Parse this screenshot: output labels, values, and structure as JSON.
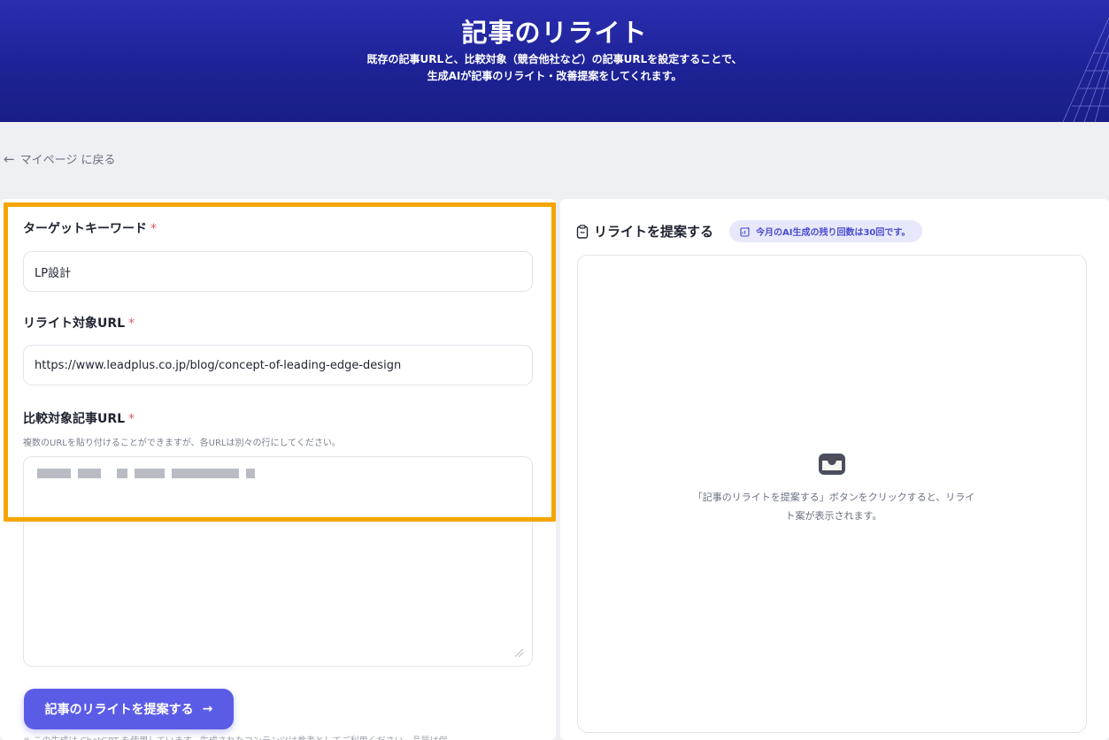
{
  "hero": {
    "title": "記事のリライト",
    "desc_line1": "既存の記事URLと、比較対象（競合他社など）の記事URLを設定することで、",
    "desc_line2": "生成AIが記事のリライト・改善提案をしてくれます。"
  },
  "nav": {
    "back_arrow": "←",
    "back_label": "マイページ に戻る"
  },
  "form": {
    "keyword_label": "ターゲットキーワード",
    "keyword_value": "LP設計",
    "target_url_label": "リライト対象URL",
    "target_url_value": "https://www.leadplus.co.jp/blog/concept-of-leading-edge-design",
    "compare_label": "比較対象記事URL",
    "compare_hint": "複数のURLを貼り付けることができますが、各URLは別々の行にしてください。",
    "required_mark": "*",
    "submit_label": "記事のリライトを提案する",
    "submit_arrow": "→",
    "footnote": "※ この生成は ChatGPT を使用しています。生成されたコンテンツは参考としてご利用ください。品質は保"
  },
  "result": {
    "title": "リライトを提案する",
    "quota_text": "今月のAI生成の残り回数は30回です。",
    "empty_line1": "「記事のリライトを提案する」ボタンをクリックすると、リライ",
    "empty_line2": "ト案が表示されます。"
  },
  "icons": {
    "back": "arrow-left-icon",
    "clipboard": "clipboard-icon",
    "quota": "sparkle-doc-icon",
    "empty": "inbox-icon"
  },
  "colors": {
    "hero": "#1d2296",
    "accent": "#5b5ce6",
    "highlight": "#f5a500",
    "required": "#e05a6a"
  }
}
